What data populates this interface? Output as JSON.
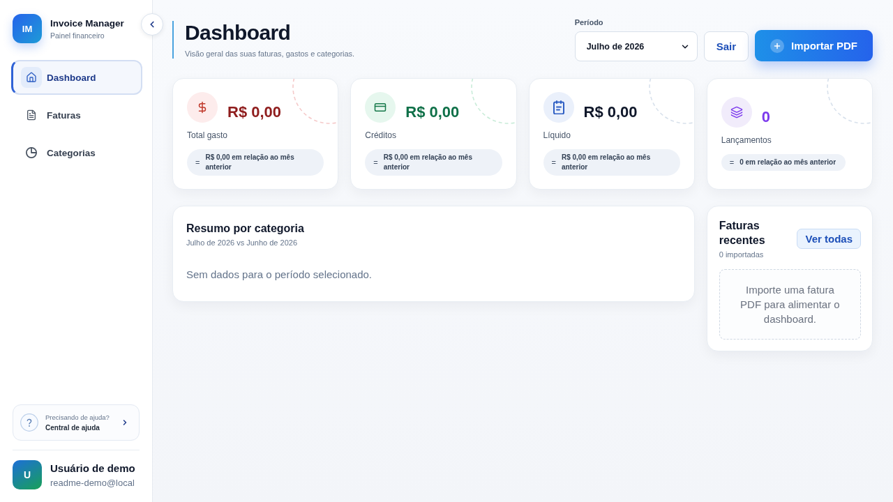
{
  "sidebar": {
    "brand": {
      "initials": "IM",
      "title": "Invoice Manager",
      "subtitle": "Painel financeiro"
    },
    "nav": [
      {
        "label": "Dashboard",
        "selected": true
      },
      {
        "label": "Faturas",
        "selected": false
      },
      {
        "label": "Categorias",
        "selected": false
      }
    ],
    "help": {
      "caption": "Precisando de ajuda?",
      "link": "Central de ajuda"
    },
    "user": {
      "initials": "U",
      "name": "Usuário de demo",
      "email": "readme-demo@local"
    }
  },
  "header": {
    "title": "Dashboard",
    "subtitle": "Visão geral das suas faturas, gastos e categorias.",
    "period": {
      "label": "Período",
      "value": "Julho de 2026"
    },
    "buttons": [
      {
        "label": "Sair",
        "kind": "secondary"
      },
      {
        "label": "Importar PDF",
        "kind": "primary"
      }
    ]
  },
  "stats": [
    {
      "kind": "expense",
      "value": "R$ 0,00",
      "label": "Total gasto",
      "trend": "=",
      "comparison": "R$ 0,00 em relação ao mês anterior"
    },
    {
      "kind": "credit",
      "value": "R$ 0,00",
      "label": "Créditos",
      "trend": "=",
      "comparison": "R$ 0,00 em relação ao mês anterior"
    },
    {
      "kind": "net",
      "value": "R$ 0,00",
      "label": "Líquido",
      "trend": "=",
      "comparison": "R$ 0,00 em relação ao mês anterior"
    },
    {
      "kind": "count",
      "value": "0",
      "label": "Lançamentos",
      "trend": "=",
      "comparison": "0 em relação ao mês anterior"
    }
  ],
  "category_summary": {
    "title": "Resumo por categoria",
    "subtitle": "Julho de 2026 vs Junho de 2026",
    "empty_message": "Sem dados para o período selecionado."
  },
  "recent_invoices": {
    "title": "Faturas recentes",
    "count": "0 importadas",
    "action": "Ver todas",
    "empty_message": "Importe uma fatura PDF para alimentar o dashboard."
  }
}
